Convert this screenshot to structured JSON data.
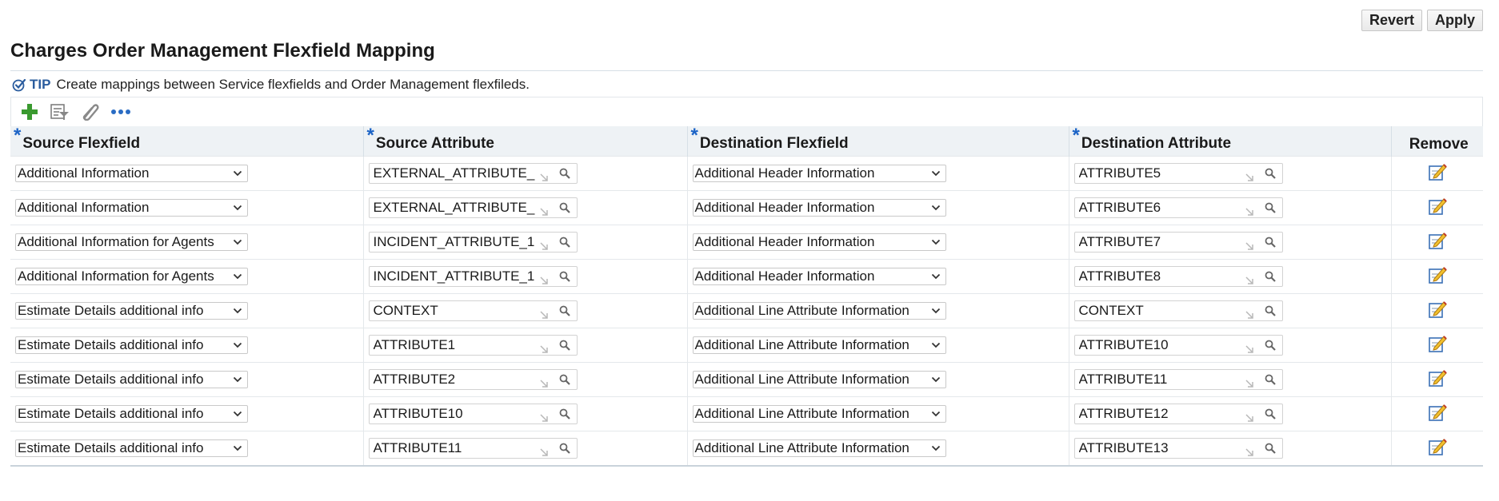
{
  "header": {
    "revert_label": "Revert",
    "apply_label": "Apply"
  },
  "page": {
    "title": "Charges Order Management Flexfield Mapping"
  },
  "tip": {
    "label": "TIP",
    "text": "Create mappings between Service flexfields and Order Management flexfileds."
  },
  "toolbar": {
    "icons": [
      "add-icon",
      "query-by-example-icon",
      "detach-icon",
      "more-icon"
    ]
  },
  "table": {
    "columns": {
      "source_flexfield": "Source Flexfield",
      "source_attribute": "Source Attribute",
      "destination_flexfield": "Destination Flexfield",
      "destination_attribute": "Destination Attribute",
      "remove": "Remove"
    },
    "rows": [
      {
        "source_flexfield": "Additional Information",
        "source_attribute": "EXTERNAL_ATTRIBUTE_",
        "destination_flexfield": "Additional Header Information",
        "destination_attribute": "ATTRIBUTE5"
      },
      {
        "source_flexfield": "Additional Information",
        "source_attribute": "EXTERNAL_ATTRIBUTE_",
        "destination_flexfield": "Additional Header Information",
        "destination_attribute": "ATTRIBUTE6"
      },
      {
        "source_flexfield": "Additional Information for Agents",
        "source_attribute": "INCIDENT_ATTRIBUTE_1",
        "destination_flexfield": "Additional Header Information",
        "destination_attribute": "ATTRIBUTE7"
      },
      {
        "source_flexfield": "Additional Information for Agents",
        "source_attribute": "INCIDENT_ATTRIBUTE_1",
        "destination_flexfield": "Additional Header Information",
        "destination_attribute": "ATTRIBUTE8"
      },
      {
        "source_flexfield": "Estimate Details additional info",
        "source_attribute": "CONTEXT",
        "destination_flexfield": "Additional Line Attribute Information",
        "destination_attribute": "CONTEXT"
      },
      {
        "source_flexfield": "Estimate Details additional info",
        "source_attribute": "ATTRIBUTE1",
        "destination_flexfield": "Additional Line Attribute Information",
        "destination_attribute": "ATTRIBUTE10"
      },
      {
        "source_flexfield": "Estimate Details additional info",
        "source_attribute": "ATTRIBUTE2",
        "destination_flexfield": "Additional Line Attribute Information",
        "destination_attribute": "ATTRIBUTE11"
      },
      {
        "source_flexfield": "Estimate Details additional info",
        "source_attribute": "ATTRIBUTE10",
        "destination_flexfield": "Additional Line Attribute Information",
        "destination_attribute": "ATTRIBUTE12"
      },
      {
        "source_flexfield": "Estimate Details additional info",
        "source_attribute": "ATTRIBUTE11",
        "destination_flexfield": "Additional Line Attribute Information",
        "destination_attribute": "ATTRIBUTE13"
      }
    ]
  },
  "colors": {
    "accent": "#1b63c6",
    "tip": "#2a5c9e",
    "add": "#3a9a2f"
  }
}
